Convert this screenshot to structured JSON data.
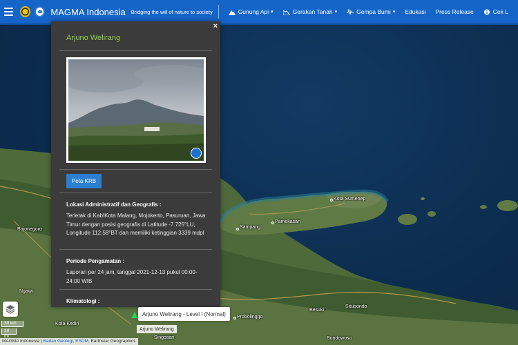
{
  "navbar": {
    "brand": "MAGMA Indonesia",
    "tagline": "Bridging the will of nature to society",
    "items": [
      {
        "label": "Gunung Api",
        "icon": "mountain-icon",
        "dropdown": true
      },
      {
        "label": "Gerakan Tanah",
        "icon": "landslide-icon",
        "dropdown": true
      },
      {
        "label": "Gempa Bumi",
        "icon": "earthquake-icon",
        "dropdown": true
      },
      {
        "label": "Edukasi",
        "icon": "",
        "dropdown": false
      },
      {
        "label": "Press Release",
        "icon": "",
        "dropdown": false
      },
      {
        "label": "Cek L",
        "icon": "info-icon",
        "dropdown": false
      }
    ]
  },
  "panel": {
    "close": "×",
    "title": "Arjuno Welirang",
    "krb_button": "Peta KRB",
    "sections": [
      {
        "heading": "Lokasi Administratif dan Geografis :",
        "text": "Terletak di Kab\\Kota Malang, Mojokerto, Pasuruan, Jawa Timur dengan posisi geografis di Latitude -7.725°LU, Longitude 112.58°BT dan memiliki ketinggian 3339 mdpl"
      },
      {
        "heading": "Periode Pengamatan :",
        "text": "Laporan per 24 jam, tanggal 2021-12-13 pukul 00:00-24:00 WIB"
      },
      {
        "heading": "Klimatologi :",
        "text": ""
      }
    ]
  },
  "map": {
    "places": [
      "Kota Sumenep",
      "Sampang",
      "Pamekasan",
      "Bojonegoro",
      "Ngawi",
      "Kota Kediri",
      "Singosari",
      "Probolinggo",
      "Besuki",
      "Situbondo",
      "Bondowoso"
    ],
    "tooltip": "Arjuno Welirang - Level I (Normal)",
    "marker_label": "Arjuno Welirang",
    "scale_km": "30 km",
    "scale_mi": "10 mi",
    "attribution": {
      "source": "MAGMA Indonesia |",
      "link1": "Badan Geologi, ESDM,",
      "rest": "Earthstar Geographics"
    },
    "colors": {
      "status_normal": "#1fd655",
      "title": "#8fd14f",
      "nav": "#1565c8"
    }
  }
}
